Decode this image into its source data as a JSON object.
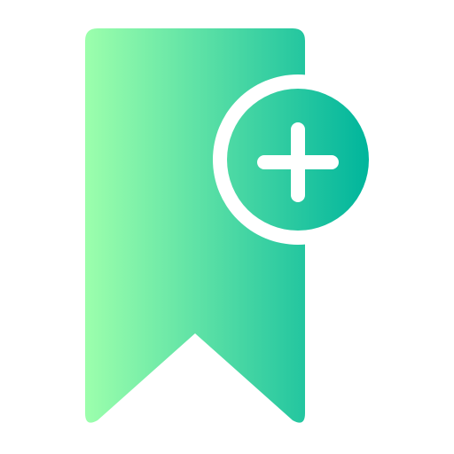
{
  "icon": {
    "name": "bookmark-add-icon",
    "description_visible": "",
    "colors": {
      "gradient_start": "#9cffac",
      "gradient_end": "#00b59c",
      "background": "#ffffff",
      "glyph": "#ffffff"
    }
  }
}
